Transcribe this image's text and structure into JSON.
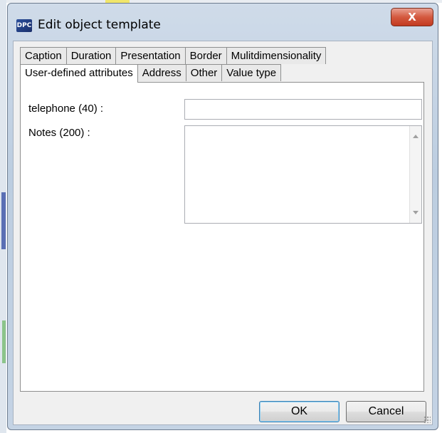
{
  "window": {
    "title": "Edit object template",
    "app_icon_text": "DPC",
    "close_label": "X"
  },
  "tabs": {
    "row1": [
      "Caption",
      "Duration",
      "Presentation",
      "Border",
      "Mulitdimensionality"
    ],
    "row2": [
      "User-defined attributes",
      "Address",
      "Other",
      "Value type"
    ],
    "active": "User-defined attributes"
  },
  "fields": {
    "telephone_label": "telephone (40) :",
    "telephone_value": "",
    "notes_label": "Notes (200) :",
    "notes_value": ""
  },
  "buttons": {
    "ok": "OK",
    "cancel": "Cancel"
  },
  "icons": {
    "close": "close-x-icon",
    "scroll_up": "scroll-up-arrow-icon",
    "scroll_down": "scroll-down-arrow-icon",
    "resize": "resize-grip-icon"
  },
  "colors": {
    "close_button": "#c9452b",
    "frame": "#bccde0",
    "client_bg": "#f0f0f0"
  }
}
